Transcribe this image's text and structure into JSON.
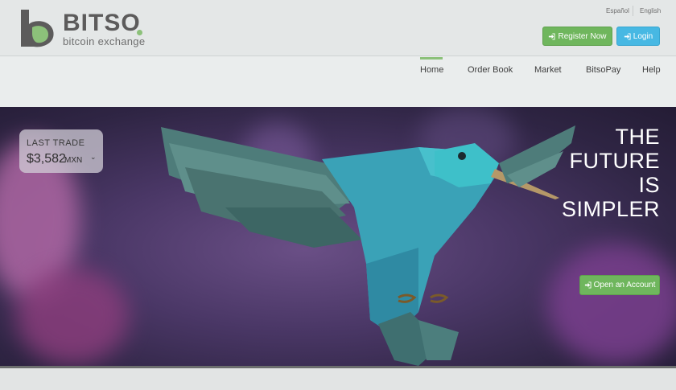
{
  "header": {
    "logo": {
      "word": "BITSO",
      "subtitle": "bitcoin exchange"
    },
    "languages": [
      "Español",
      "English"
    ],
    "register_label": "Register Now",
    "login_label": "Login"
  },
  "nav": {
    "items": [
      {
        "label": "Home",
        "active": true
      },
      {
        "label": "Order Book"
      },
      {
        "label": "Market"
      },
      {
        "label": "BitsoPay"
      },
      {
        "label": "Help"
      }
    ]
  },
  "hero": {
    "last_trade_label": "LAST TRADE",
    "last_trade_value": "$3,582",
    "last_trade_unit": "MXN",
    "tagline": [
      "THE",
      "FUTURE",
      "IS",
      "SIMPLER"
    ],
    "cta_label": "Open an Account"
  },
  "colors": {
    "brand_green": "#6fb65d",
    "login_blue": "#47b8e3",
    "logo_gray": "#5c5b5b",
    "hummingbird_teal": "#3fa6b4"
  },
  "icons": {
    "sign_in": "sign-in-icon",
    "chevron": "chevron-down-icon"
  }
}
